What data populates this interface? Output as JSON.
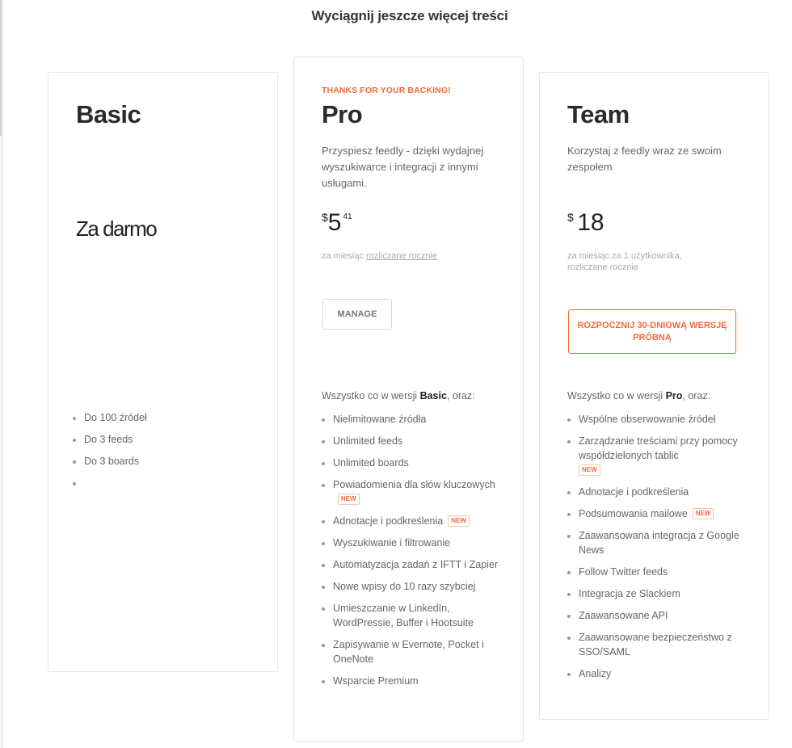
{
  "page": {
    "title": "Wyciągnij jeszcze więcej treści"
  },
  "plans": {
    "basic": {
      "name": "Basic",
      "price_label": "Za darmo",
      "features": [
        "Do 100 źródeł",
        "Do 3 feeds",
        "Do 3 boards",
        ""
      ]
    },
    "pro": {
      "kicker": "THANKS FOR YOUR BACKING!",
      "name": "Pro",
      "description": "Przyspiesz feedly - dzięki wydajnej wyszukiwarce i integracji z innymi usługami.",
      "price": {
        "currency": "$",
        "whole": "5",
        "cents": "41"
      },
      "billing_prefix": "za miesiąc",
      "billing_link": "rozliczane rocznie",
      "button_label": "MANAGE",
      "intro_prefix": "Wszystko co w wersji",
      "intro_plan": "Basic",
      "intro_suffix": ", oraz:",
      "features": [
        {
          "text": "Nielimitowane źródła"
        },
        {
          "text": "Unlimited feeds"
        },
        {
          "text": "Unlimited boards"
        },
        {
          "text": "Powiadomienia dla słów kluczowych",
          "badge": "NEW"
        },
        {
          "text": "Adnotacje i podkreślenia",
          "badge": "NEW"
        },
        {
          "text": "Wyszukiwanie i filtrowanie"
        },
        {
          "text": "Automatyzacja zadań z IFTT i Zapier"
        },
        {
          "text": "Nowe wpisy do 10 razy szybciej"
        },
        {
          "text": "Umieszczanie w LinkedIn, WordPressie, Buffer i Hootsuite"
        },
        {
          "text": "Zapisywanie w Evernote, Pocket i OneNote"
        },
        {
          "text": "Wsparcie Premium"
        }
      ]
    },
    "team": {
      "name": "Team",
      "description": "Korzystaj z feedly wraz ze swoim zespołem",
      "price": {
        "currency": "$",
        "whole": "18"
      },
      "billing": "za miesiąc za 1 użytkownika, rozliczane rocznie",
      "button_label": "ROZPOCZNIJ 30-DNIOWĄ WERSJĘ PRÓBNĄ",
      "intro_prefix": "Wszystko co w wersji",
      "intro_plan": "Pro",
      "intro_suffix": ", oraz:",
      "features": [
        {
          "text": "Wspólne obserwowanie źródeł"
        },
        {
          "text": "Zarządzanie treściami przy pomocy współdzielonych tablic",
          "badge": "NEW",
          "badge_newline": true
        },
        {
          "text": "Adnotacje i podkreślenia"
        },
        {
          "text": "Podsumowania mailowe",
          "badge": "NEW"
        },
        {
          "text": "Zaawansowana integracja z Google News"
        },
        {
          "text": "Follow Twitter feeds"
        },
        {
          "text": "Integracja ze Slackiem"
        },
        {
          "text": "Zaawansowane API"
        },
        {
          "text": "Zaawansowane bezpieczeństwo z SSO/SAML"
        },
        {
          "text": "Analizy"
        }
      ]
    }
  },
  "colors": {
    "accent": "#f26a3a",
    "text": "#333333",
    "muted": "#aaaaaa",
    "border": "#e3e6e8"
  }
}
